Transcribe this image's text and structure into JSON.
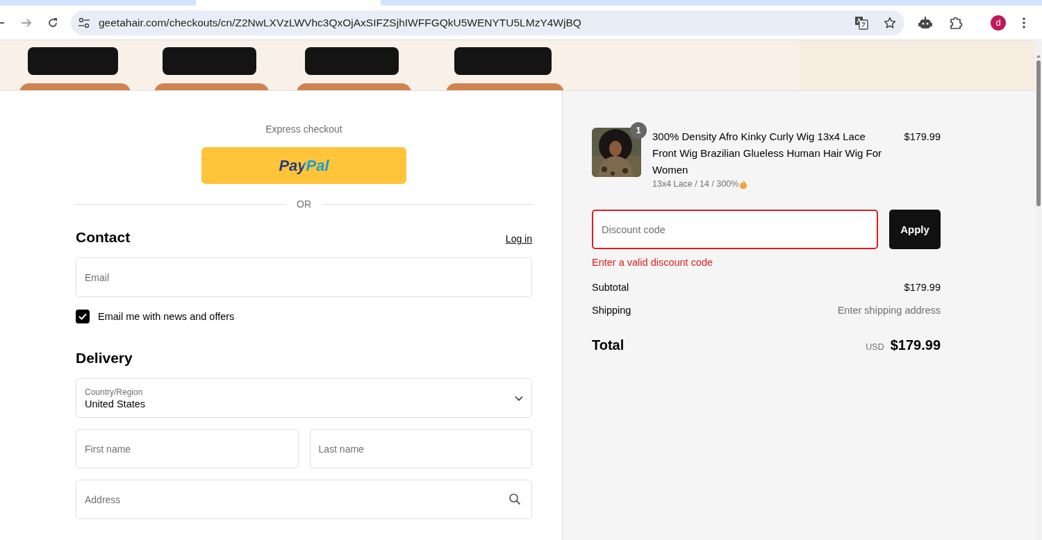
{
  "browser": {
    "url": "geetahair.com/checkouts/cn/Z2NwLXVzLWVhc3QxOjAxSIFZSjhIWFFGQkU5WENYTU5LMzY4WjBQ",
    "avatar": "d"
  },
  "express": {
    "title": "Express checkout",
    "paypal": "PayPal",
    "divider": "OR"
  },
  "contact": {
    "heading": "Contact",
    "login": "Log in",
    "email_placeholder": "Email",
    "newsletter": {
      "label": "Email me with news and offers",
      "checked": true
    }
  },
  "delivery": {
    "heading": "Delivery",
    "country": {
      "label": "Country/Region",
      "value": "United States"
    },
    "first_name_placeholder": "First name",
    "last_name_placeholder": "Last name",
    "address_placeholder": "Address"
  },
  "summary": {
    "item": {
      "quantity": "1",
      "title": "300% Density Afro Kinky Curly Wig 13x4 Lace Front Wig Brazilian Glueless Human Hair Wig For Women",
      "variant": "13x4 Lace / 14 / 300%",
      "price": "$179.99"
    },
    "discount": {
      "placeholder": "Discount code",
      "invalid": true,
      "error": "Enter a valid discount code",
      "button": "Apply"
    },
    "subtotal": {
      "label": "Subtotal",
      "value": "$179.99"
    },
    "shipping": {
      "label": "Shipping",
      "value": "Enter shipping address"
    },
    "total": {
      "label": "Total",
      "currency": "USD",
      "value": "$179.99"
    }
  }
}
